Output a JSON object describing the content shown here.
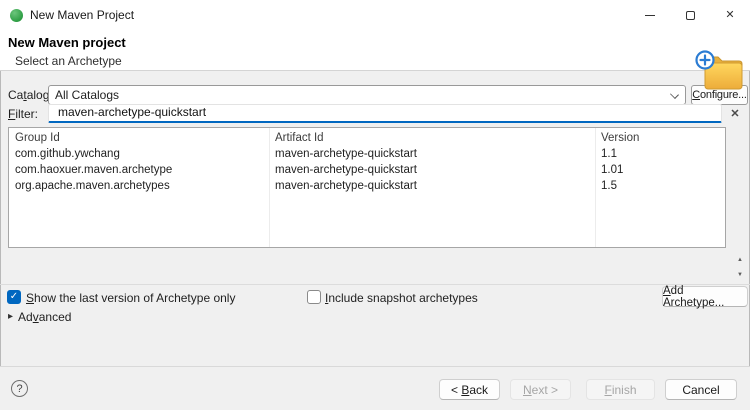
{
  "window": {
    "title": "New Maven Project"
  },
  "icons": {
    "close": "✕",
    "clear": "✕",
    "check": "✓",
    "scroll_up": "▲",
    "scroll_down": "▼",
    "advanced_arrow": "▸",
    "help": "?"
  },
  "header": {
    "title": "New Maven project",
    "subtitle": "Select an Archetype"
  },
  "catalog": {
    "label": {
      "pre": "Ca",
      "key": "t",
      "post": "alog:"
    },
    "value": "All Catalogs",
    "configure_button": {
      "pre": "",
      "key": "C",
      "post": "onfigure..."
    }
  },
  "filter": {
    "label": {
      "pre": "",
      "key": "F",
      "post": "ilter:"
    },
    "value": "maven-archetype-quickstart"
  },
  "table": {
    "columns": [
      "Group Id",
      "Artifact Id",
      "Version"
    ],
    "rows": [
      [
        "com.github.ywchang",
        "maven-archetype-quickstart",
        "1.1"
      ],
      [
        "com.haoxuer.maven.archetype",
        "maven-archetype-quickstart",
        "1.01"
      ],
      [
        "org.apache.maven.archetypes",
        "maven-archetype-quickstart",
        "1.5"
      ]
    ]
  },
  "options": {
    "show_last_version": {
      "checked": true,
      "label": {
        "pre": "",
        "key": "S",
        "post": "how the last version of Archetype only"
      }
    },
    "include_snapshots": {
      "checked": false,
      "label": {
        "pre": "",
        "key": "I",
        "post": "nclude snapshot archetypes"
      }
    },
    "add_archetype_button": {
      "pre": "",
      "key": "A",
      "post": "dd Archetype..."
    }
  },
  "advanced": {
    "label": {
      "pre": "Ad",
      "key": "v",
      "post": "anced"
    }
  },
  "footer": {
    "back_button": {
      "pre": "< ",
      "key": "B",
      "post": "ack"
    },
    "next_button": {
      "pre": "",
      "key": "N",
      "post": "ext >"
    },
    "finish_button": {
      "pre": "",
      "key": "F",
      "post": "inish"
    },
    "cancel_button": "Cancel"
  }
}
